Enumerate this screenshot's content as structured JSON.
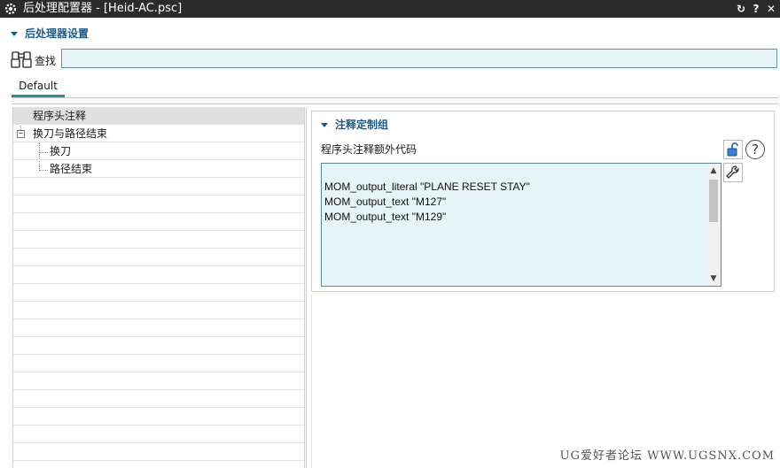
{
  "window": {
    "title": "后处理配置器 - [Heid-AC.psc]",
    "controls": [
      "↻",
      "?",
      "✕"
    ]
  },
  "section": {
    "title": "后处理器设置"
  },
  "find": {
    "label": "查找",
    "value": ""
  },
  "tabs": [
    {
      "label": "Default",
      "active": true
    }
  ],
  "tree": {
    "items": [
      {
        "label": "程序头注释",
        "selected": true
      },
      {
        "label": "换刀与路径结束",
        "expanded": true
      },
      {
        "label": "换刀"
      },
      {
        "label": "路径结束"
      }
    ]
  },
  "group": {
    "title": "注释定制组",
    "field_label": "程序头注释额外代码",
    "code_lines": [
      "",
      "MOM_output_literal \"PLANE RESET STAY\"",
      "MOM_output_text \"M127\"",
      "MOM_output_text \"M129\""
    ]
  },
  "watermark": "UG爱好者论坛 WWW.UGSNX.COM"
}
